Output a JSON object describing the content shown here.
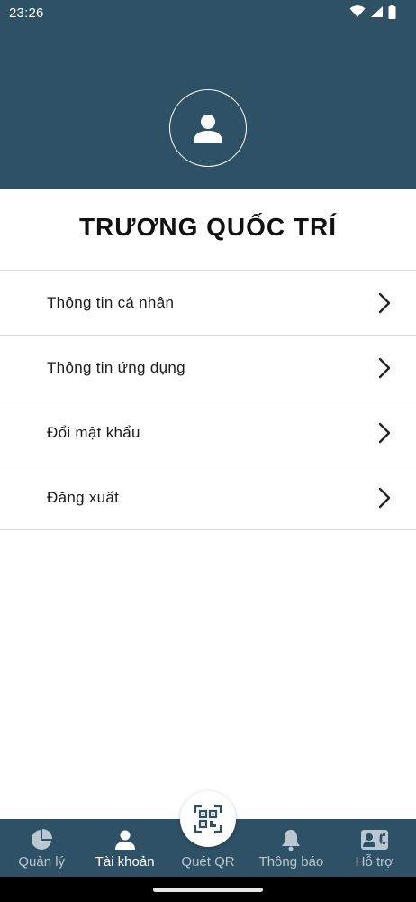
{
  "status_bar": {
    "time": "23:26"
  },
  "profile": {
    "name": "TRƯƠNG QUỐC TRÍ"
  },
  "menu": {
    "items": [
      {
        "label": "Thông tin cá nhân"
      },
      {
        "label": "Thông tin ứng dụng"
      },
      {
        "label": "Đổi mật khẩu"
      },
      {
        "label": "Đăng xuất"
      }
    ]
  },
  "bottom_nav": {
    "items": [
      {
        "label": "Quản lý",
        "icon": "pie-chart-icon"
      },
      {
        "label": "Tài khoản",
        "icon": "person-icon",
        "active": true
      },
      {
        "label": "Quét QR",
        "icon": "qr-code-icon"
      },
      {
        "label": "Thông báo",
        "icon": "bell-icon"
      },
      {
        "label": "Hỗ trợ",
        "icon": "contact-support-icon"
      }
    ]
  },
  "colors": {
    "primary": "#2e5166",
    "nav_inactive": "#b8c7d1",
    "text": "#1a1a1a"
  }
}
